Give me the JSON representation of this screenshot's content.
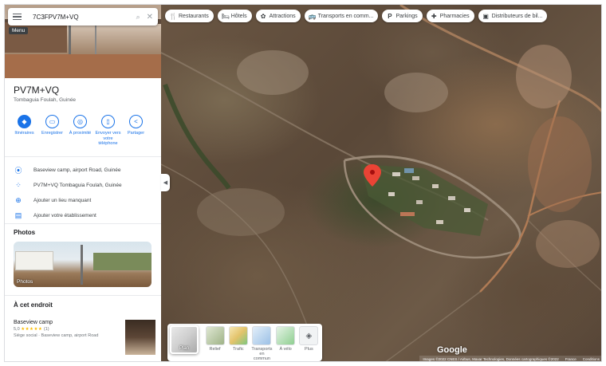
{
  "search": {
    "query": "7C3FPV7M+VQ",
    "menu_tooltip": "Menu"
  },
  "place": {
    "title": "PV7M+VQ",
    "subtitle": "Tombaguia Foulah, Guinée"
  },
  "actions": [
    {
      "icon": "directions-icon",
      "label": "Itinéraires"
    },
    {
      "icon": "bookmark-icon",
      "label": "Enregistrer"
    },
    {
      "icon": "nearby-icon",
      "label": "À proximité"
    },
    {
      "icon": "phone-send-icon",
      "label": "Envoyer vers votre téléphone"
    },
    {
      "icon": "share-icon",
      "label": "Partager"
    }
  ],
  "info": [
    {
      "icon": "location-pin-icon",
      "text": "Baseview camp, airport Road, Guinée"
    },
    {
      "icon": "plus-code-icon",
      "text": "PV7M+VQ Tombaguia Foulah, Guinée"
    },
    {
      "icon": "add-place-icon",
      "text": "Ajouter un lieu manquant"
    },
    {
      "icon": "add-business-icon",
      "text": "Ajouter votre établissement"
    }
  ],
  "photos": {
    "heading": "Photos",
    "card_label": "Photos"
  },
  "nearby": {
    "heading": "À cet endroit",
    "item": {
      "name": "Baseview camp",
      "rating": "5,0",
      "stars": "★★★★★",
      "reviews": "(1)",
      "address": "Siège social · Baseview camp, airport Road"
    }
  },
  "chips": [
    {
      "icon": "restaurant-icon",
      "glyph": "🍴",
      "label": "Restaurants"
    },
    {
      "icon": "hotel-icon",
      "glyph": "🛏",
      "label": "Hôtels"
    },
    {
      "icon": "attractions-icon",
      "glyph": "✿",
      "label": "Attractions"
    },
    {
      "icon": "transit-icon",
      "glyph": "🚌",
      "label": "Transports en comm..."
    },
    {
      "icon": "parking-icon",
      "glyph": "P",
      "label": "Parkings"
    },
    {
      "icon": "pharmacy-icon",
      "glyph": "✚",
      "label": "Pharmacies"
    },
    {
      "icon": "atm-icon",
      "glyph": "▣",
      "label": "Distributeurs de bil..."
    }
  ],
  "layers": {
    "plan_label": "Plan",
    "items": [
      {
        "label": "Relief",
        "color": "#b9c9a3"
      },
      {
        "label": "Trafic",
        "color": "#e9d9a6"
      },
      {
        "label": "Transports en commun",
        "color": "#cfe0f1"
      },
      {
        "label": "À vélo",
        "color": "#c8e6c9"
      },
      {
        "label": "Plus",
        "color": "#f1f3f4"
      }
    ]
  },
  "map": {
    "logo": "Google",
    "attribution": "Images ©2022 CNES / Airbus, Maxar Technologies, Données cartographiques ©2022",
    "country": "France",
    "terms": "Conditions",
    "accent": "#1a73e8",
    "marker_color": "#ea4335"
  }
}
